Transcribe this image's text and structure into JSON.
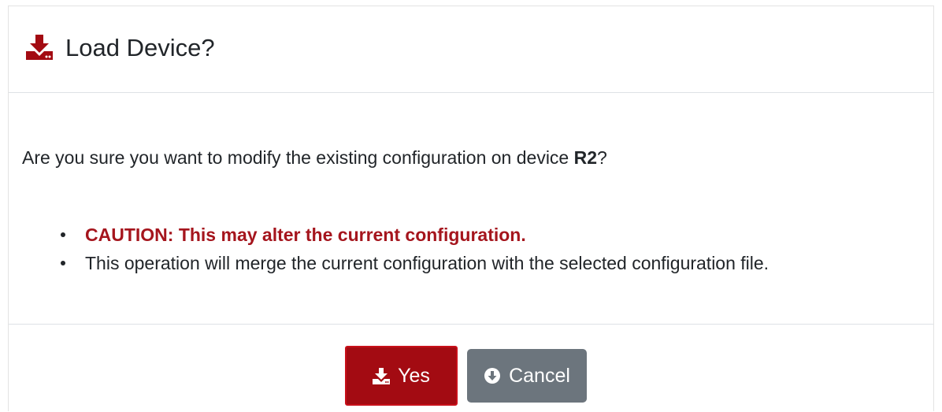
{
  "dialog": {
    "title": "Load Device?",
    "title_icon": "download-icon",
    "question_prefix": "Are you sure you want to modify the existing configuration on device ",
    "device_name": "R2",
    "question_suffix": "?",
    "caution": "CAUTION: This may alter the current configuration.",
    "info": "This operation will merge the current configuration with the selected configuration file.",
    "yes_label": "Yes",
    "yes_icon": "download-icon",
    "cancel_label": "Cancel",
    "cancel_icon": "circle-arrow-down-icon"
  },
  "colors": {
    "accent": "#a30b12",
    "caution_text": "#a5151d",
    "cancel_bg": "#6c757d"
  }
}
